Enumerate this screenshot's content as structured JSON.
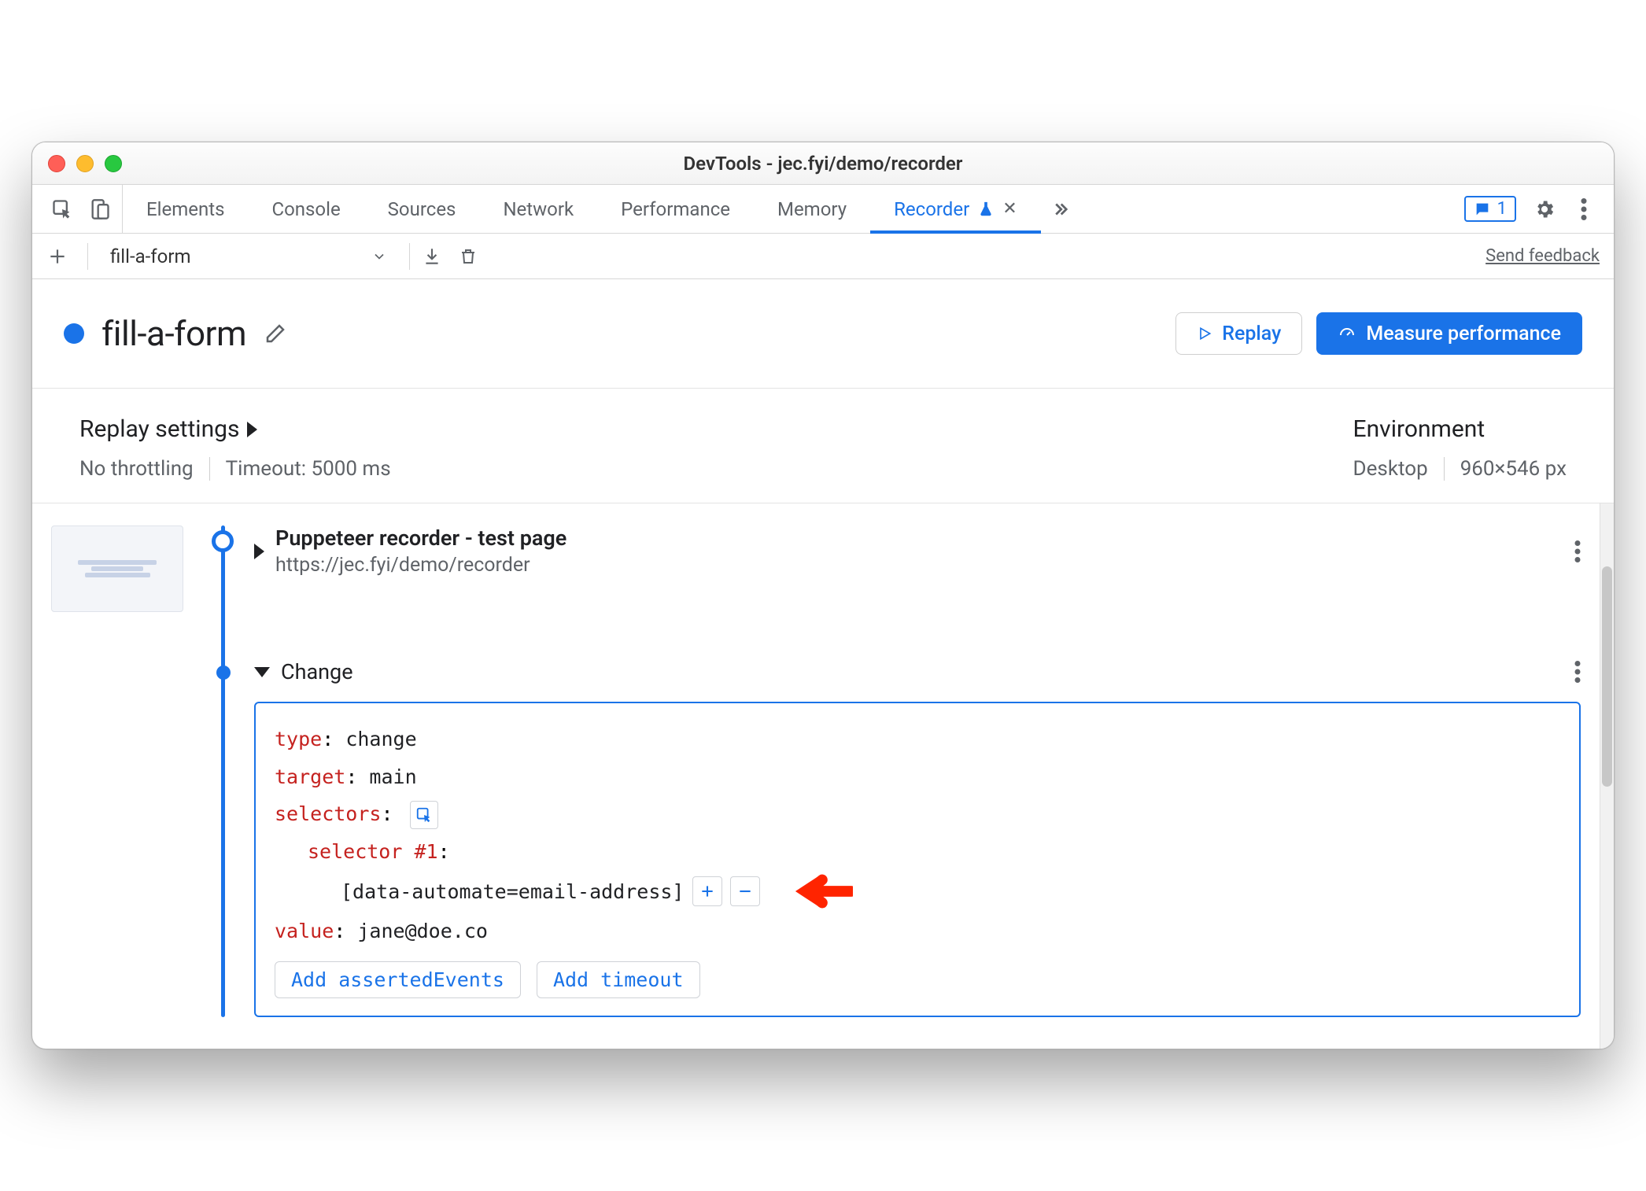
{
  "window": {
    "title": "DevTools - jec.fyi/demo/recorder"
  },
  "tabs": {
    "items": [
      "Elements",
      "Console",
      "Sources",
      "Network",
      "Performance",
      "Memory",
      "Recorder"
    ],
    "active": "Recorder",
    "feedback_count": "1"
  },
  "toolbar": {
    "recording_name": "fill-a-form",
    "send_feedback": "Send feedback"
  },
  "header": {
    "title": "fill-a-form",
    "replay_label": "Replay",
    "measure_label": "Measure performance"
  },
  "settings": {
    "replay_title": "Replay settings",
    "throttling": "No throttling",
    "timeout": "Timeout: 5000 ms",
    "env_title": "Environment",
    "device": "Desktop",
    "resolution": "960×546 px"
  },
  "steps": {
    "first": {
      "title": "Puppeteer recorder - test page",
      "url": "https://jec.fyi/demo/recorder"
    },
    "change": {
      "label": "Change",
      "type_key": "type",
      "type_val": "change",
      "target_key": "target",
      "target_val": "main",
      "selectors_key": "selectors",
      "selector_n_key": "selector #1",
      "selector_val": "[data-automate=email-address]",
      "value_key": "value",
      "value_val": "jane@doe.co",
      "add_asserted": "Add assertedEvents",
      "add_timeout": "Add timeout"
    }
  }
}
